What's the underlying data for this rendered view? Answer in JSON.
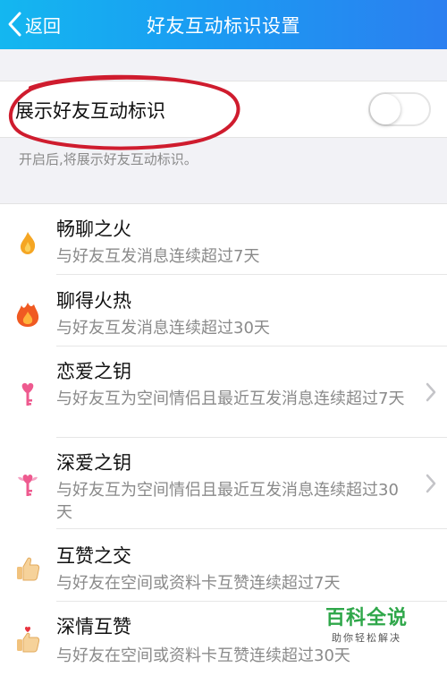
{
  "header": {
    "back_label": "返回",
    "title": "好友互动标识设置"
  },
  "setting": {
    "label": "展示好友互动标识",
    "enabled": false
  },
  "hint": "开启后,将展示好友互动标识。",
  "items": [
    {
      "name": "畅聊之火",
      "desc": "与好友互发消息连续超过7天",
      "icon": "small-flame-icon"
    },
    {
      "name": "聊得火热",
      "desc": "与好友互发消息连续超过30天",
      "icon": "big-flame-icon"
    },
    {
      "name": "恋爱之钥",
      "desc": "与好友互为空间情侣且最近互发消息连续超过7天",
      "icon": "pink-heart-key-icon"
    },
    {
      "name": "深爱之钥",
      "desc": "与好友互为空间情侣且最近互发消息连续超过30天",
      "icon": "winged-heart-key-icon"
    },
    {
      "name": "互赞之交",
      "desc": "与好友在空间或资料卡互赞连续超过7天",
      "icon": "thumbs-up-icon"
    },
    {
      "name": "深情互赞",
      "desc": "与好友在空间或资料卡互赞连续超过30天",
      "icon": "heart-thumbs-up-icon"
    }
  ],
  "watermark": {
    "main": "百科全说",
    "sub": "助你轻松解决"
  },
  "colors": {
    "header_start": "#14b7f0",
    "header_end": "#2b7ff0",
    "annotation_circle": "#cf1c2e"
  }
}
